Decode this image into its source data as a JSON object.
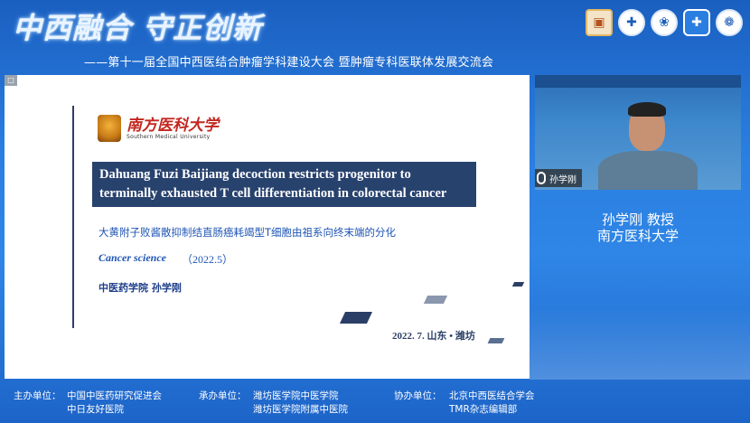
{
  "header": {
    "brand": "中西融合 守正创新",
    "subtitle": "——第十一届全国中西医结合肿瘤学科建设大会  暨肿瘤专科医联体发展交流会"
  },
  "logos": [
    {
      "icon": "book-icon",
      "glyph": "▣"
    },
    {
      "icon": "hospital-emblem-icon",
      "glyph": "✚"
    },
    {
      "icon": "university-emblem-icon",
      "glyph": "❀"
    },
    {
      "icon": "medical-cross-icon",
      "glyph": "✚"
    },
    {
      "icon": "association-emblem-icon",
      "glyph": "❁"
    }
  ],
  "slide": {
    "corner": "□",
    "university_cn": "南方医科大学",
    "university_en": "Southern Medical University",
    "title_line1": "Dahuang Fuzi Baijiang decoction restricts progenitor to",
    "title_line2": "terminally exhausted T cell differentiation in colorectal cancer",
    "cn_title": "大黄附子败酱散抑制结直肠癌耗竭型T细胞由祖系向终末端的分化",
    "journal": "Cancer science",
    "year": "（2022.5）",
    "author": "中医药学院 孙学刚",
    "date": "2022. 7.    山东 • 潍坊"
  },
  "video": {
    "screen_text": "",
    "name_tag": "孙学刚"
  },
  "speaker": {
    "name": "孙学刚 教授",
    "org": "南方医科大学"
  },
  "footer": {
    "host_label": "主办单位：",
    "host_1": "中国中医药研究促进会",
    "host_2": "中日友好医院",
    "organizer_label": "承办单位：",
    "organizer_1": "潍坊医学院中医学院",
    "organizer_2": "潍坊医学院附属中医院",
    "co_label": "协办单位：",
    "co_1": "北京中西医结合学会",
    "co_2": "TMR杂志编辑部"
  },
  "colors": {
    "background": "#2a7ee0",
    "title_box": "#28426e",
    "accent_blue": "#1f56b4",
    "university_red": "#c3271f"
  }
}
